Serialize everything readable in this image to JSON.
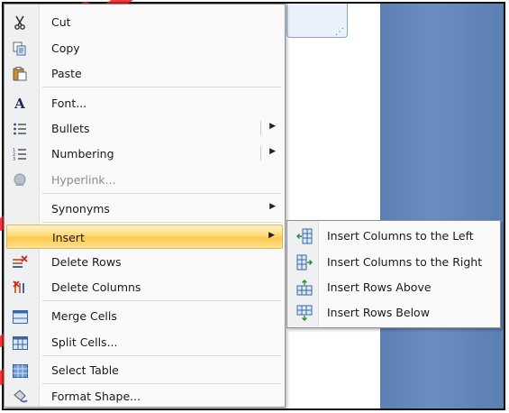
{
  "menu": {
    "items": [
      {
        "label": "Cut",
        "icon": "scissors-icon"
      },
      {
        "label": "Copy",
        "icon": "copy-icon"
      },
      {
        "label": "Paste",
        "icon": "paste-icon"
      },
      {
        "label": "Font...",
        "icon": "font-icon"
      },
      {
        "label": "Bullets",
        "icon": "bullets-icon"
      },
      {
        "label": "Numbering",
        "icon": "numbering-icon"
      },
      {
        "label": "Hyperlink...",
        "icon": "hyperlink-icon"
      },
      {
        "label": "Synonyms",
        "icon": ""
      },
      {
        "label": "Insert",
        "icon": ""
      },
      {
        "label": "Delete Rows",
        "icon": "delete-rows-icon"
      },
      {
        "label": "Delete Columns",
        "icon": "delete-columns-icon"
      },
      {
        "label": "Merge Cells",
        "icon": "merge-cells-icon"
      },
      {
        "label": "Split Cells...",
        "icon": "split-cells-icon"
      },
      {
        "label": "Select Table",
        "icon": "select-table-icon"
      },
      {
        "label": "Format Shape...",
        "icon": "format-shape-icon"
      }
    ]
  },
  "submenu": {
    "items": [
      {
        "label": "Insert Columns to the Left",
        "icon": "insert-columns-left-icon"
      },
      {
        "label": "Insert Columns to the Right",
        "icon": "insert-columns-right-icon"
      },
      {
        "label": "Insert Rows Above",
        "icon": "insert-rows-above-icon"
      },
      {
        "label": "Insert Rows Below",
        "icon": "insert-rows-below-icon"
      }
    ]
  },
  "colors": {
    "highlight": "#ffd97a",
    "watermark": "#e01010",
    "doc_blue": "#5c80b4"
  }
}
